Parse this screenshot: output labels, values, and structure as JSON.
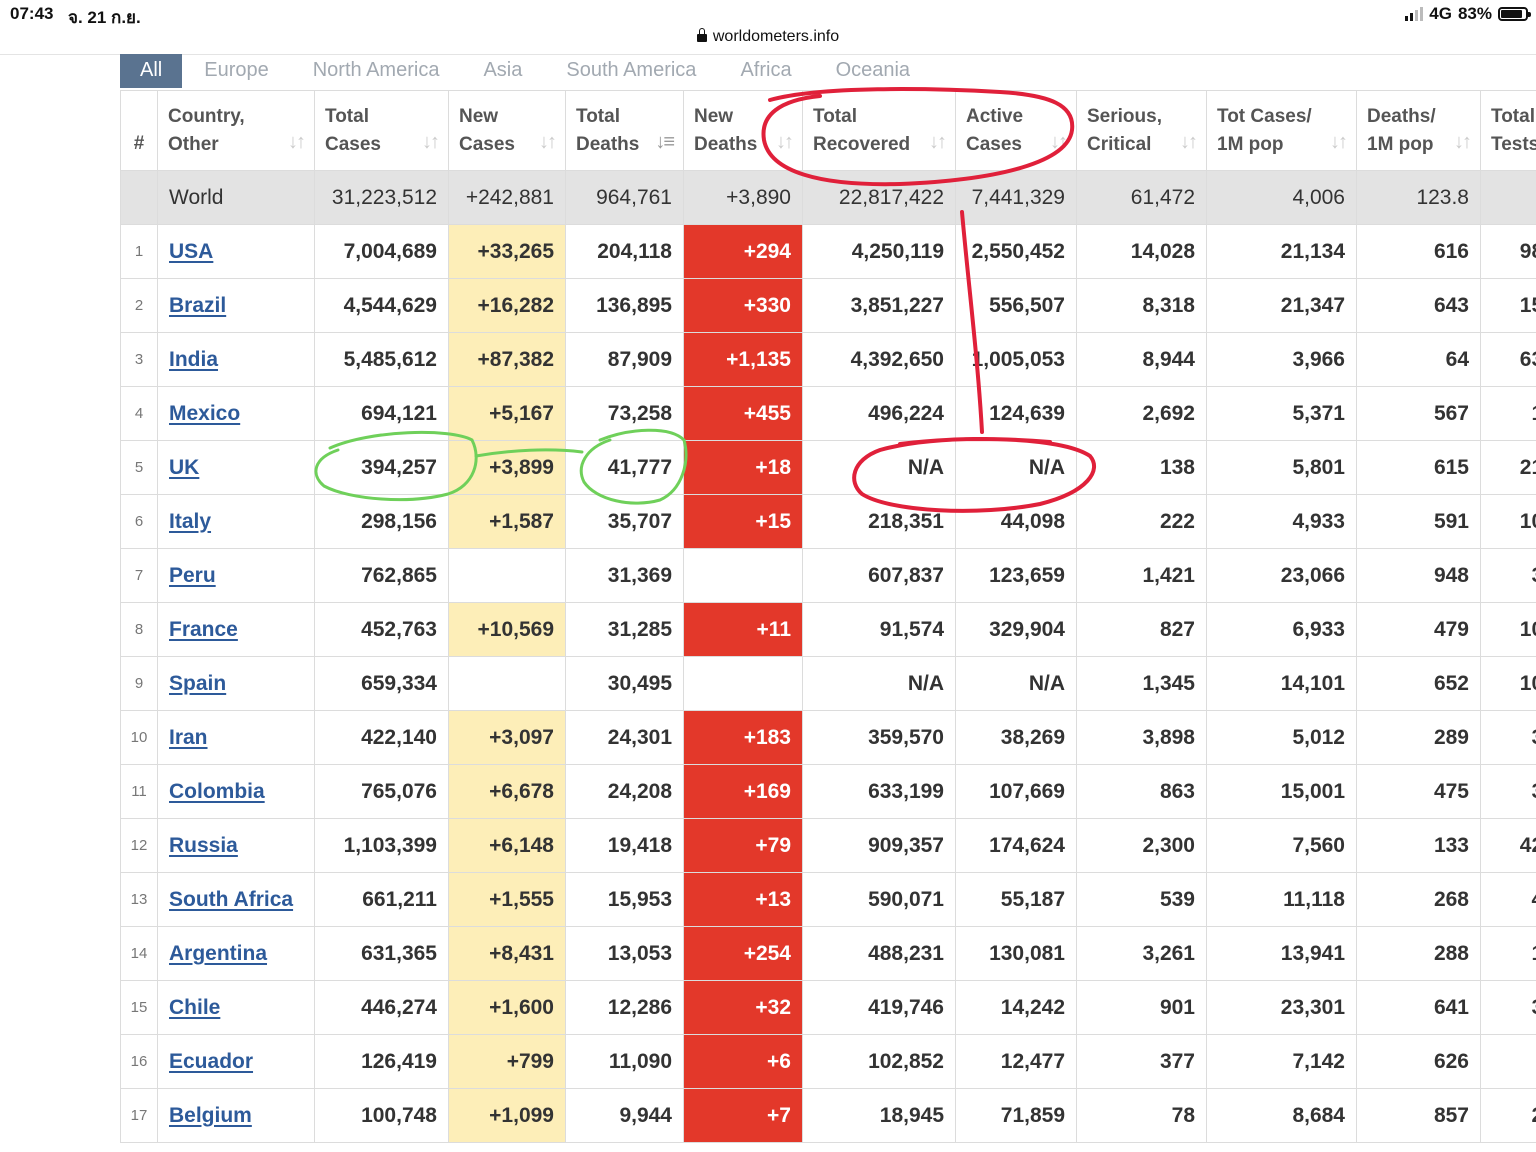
{
  "status_bar": {
    "time": "07:43",
    "date": "จ. 21 ก.ย.",
    "network": "4G",
    "battery": "83%"
  },
  "url_bar": {
    "domain": "worldometers.info"
  },
  "region_tabs": [
    "All",
    "Europe",
    "North America",
    "Asia",
    "South America",
    "Africa",
    "Oceania"
  ],
  "active_tab": "All",
  "table": {
    "headers": [
      {
        "line1": "#",
        "line2": ""
      },
      {
        "line1": "Country,",
        "line2": "Other"
      },
      {
        "line1": "Total",
        "line2": "Cases"
      },
      {
        "line1": "New",
        "line2": "Cases"
      },
      {
        "line1": "Total",
        "line2": "Deaths"
      },
      {
        "line1": "New",
        "line2": "Deaths"
      },
      {
        "line1": "Total",
        "line2": "Recovered"
      },
      {
        "line1": "Active",
        "line2": "Cases"
      },
      {
        "line1": "Serious,",
        "line2": "Critical"
      },
      {
        "line1": "Tot Cases/",
        "line2": "1M pop"
      },
      {
        "line1": "Deaths/",
        "line2": "1M pop"
      },
      {
        "line1": "Total",
        "line2": "Tests"
      }
    ],
    "world_row": {
      "country": "World",
      "total_cases": "31,223,512",
      "new_cases": "+242,881",
      "total_deaths": "964,761",
      "new_deaths": "+3,890",
      "total_recovered": "22,817,422",
      "active_cases": "7,441,329",
      "serious_critical": "61,472",
      "cases_per_1m": "4,006",
      "deaths_per_1m": "123.8",
      "total_tests": ""
    },
    "rows": [
      {
        "rank": "1",
        "country": "USA",
        "total_cases": "7,004,689",
        "new_cases": "+33,265",
        "total_deaths": "204,118",
        "new_deaths": "+294",
        "total_recovered": "4,250,119",
        "active_cases": "2,550,452",
        "serious_critical": "14,028",
        "cases_per_1m": "21,134",
        "deaths_per_1m": "616",
        "total_tests": "98,"
      },
      {
        "rank": "2",
        "country": "Brazil",
        "total_cases": "4,544,629",
        "new_cases": "+16,282",
        "total_deaths": "136,895",
        "new_deaths": "+330",
        "total_recovered": "3,851,227",
        "active_cases": "556,507",
        "serious_critical": "8,318",
        "cases_per_1m": "21,347",
        "deaths_per_1m": "643",
        "total_tests": "15,"
      },
      {
        "rank": "3",
        "country": "India",
        "total_cases": "5,485,612",
        "new_cases": "+87,382",
        "total_deaths": "87,909",
        "new_deaths": "+1,135",
        "total_recovered": "4,392,650",
        "active_cases": "1,005,053",
        "serious_critical": "8,944",
        "cases_per_1m": "3,966",
        "deaths_per_1m": "64",
        "total_tests": "63,"
      },
      {
        "rank": "4",
        "country": "Mexico",
        "total_cases": "694,121",
        "new_cases": "+5,167",
        "total_deaths": "73,258",
        "new_deaths": "+455",
        "total_recovered": "496,224",
        "active_cases": "124,639",
        "serious_critical": "2,692",
        "cases_per_1m": "5,371",
        "deaths_per_1m": "567",
        "total_tests": "1,"
      },
      {
        "rank": "5",
        "country": "UK",
        "total_cases": "394,257",
        "new_cases": "+3,899",
        "total_deaths": "41,777",
        "new_deaths": "+18",
        "total_recovered": "N/A",
        "active_cases": "N/A",
        "serious_critical": "138",
        "cases_per_1m": "5,801",
        "deaths_per_1m": "615",
        "total_tests": "21,"
      },
      {
        "rank": "6",
        "country": "Italy",
        "total_cases": "298,156",
        "new_cases": "+1,587",
        "total_deaths": "35,707",
        "new_deaths": "+15",
        "total_recovered": "218,351",
        "active_cases": "44,098",
        "serious_critical": "222",
        "cases_per_1m": "4,933",
        "deaths_per_1m": "591",
        "total_tests": "10,"
      },
      {
        "rank": "7",
        "country": "Peru",
        "total_cases": "762,865",
        "new_cases": "",
        "total_deaths": "31,369",
        "new_deaths": "",
        "total_recovered": "607,837",
        "active_cases": "123,659",
        "serious_critical": "1,421",
        "cases_per_1m": "23,066",
        "deaths_per_1m": "948",
        "total_tests": "3,"
      },
      {
        "rank": "8",
        "country": "France",
        "total_cases": "452,763",
        "new_cases": "+10,569",
        "total_deaths": "31,285",
        "new_deaths": "+11",
        "total_recovered": "91,574",
        "active_cases": "329,904",
        "serious_critical": "827",
        "cases_per_1m": "6,933",
        "deaths_per_1m": "479",
        "total_tests": "10,"
      },
      {
        "rank": "9",
        "country": "Spain",
        "total_cases": "659,334",
        "new_cases": "",
        "total_deaths": "30,495",
        "new_deaths": "",
        "total_recovered": "N/A",
        "active_cases": "N/A",
        "serious_critical": "1,345",
        "cases_per_1m": "14,101",
        "deaths_per_1m": "652",
        "total_tests": "10,"
      },
      {
        "rank": "10",
        "country": "Iran",
        "total_cases": "422,140",
        "new_cases": "+3,097",
        "total_deaths": "24,301",
        "new_deaths": "+183",
        "total_recovered": "359,570",
        "active_cases": "38,269",
        "serious_critical": "3,898",
        "cases_per_1m": "5,012",
        "deaths_per_1m": "289",
        "total_tests": "3,"
      },
      {
        "rank": "11",
        "country": "Colombia",
        "total_cases": "765,076",
        "new_cases": "+6,678",
        "total_deaths": "24,208",
        "new_deaths": "+169",
        "total_recovered": "633,199",
        "active_cases": "107,669",
        "serious_critical": "863",
        "cases_per_1m": "15,001",
        "deaths_per_1m": "475",
        "total_tests": "3,"
      },
      {
        "rank": "12",
        "country": "Russia",
        "total_cases": "1,103,399",
        "new_cases": "+6,148",
        "total_deaths": "19,418",
        "new_deaths": "+79",
        "total_recovered": "909,357",
        "active_cases": "174,624",
        "serious_critical": "2,300",
        "cases_per_1m": "7,560",
        "deaths_per_1m": "133",
        "total_tests": "42,"
      },
      {
        "rank": "13",
        "country": "South Africa",
        "total_cases": "661,211",
        "new_cases": "+1,555",
        "total_deaths": "15,953",
        "new_deaths": "+13",
        "total_recovered": "590,071",
        "active_cases": "55,187",
        "serious_critical": "539",
        "cases_per_1m": "11,118",
        "deaths_per_1m": "268",
        "total_tests": "4,"
      },
      {
        "rank": "14",
        "country": "Argentina",
        "total_cases": "631,365",
        "new_cases": "+8,431",
        "total_deaths": "13,053",
        "new_deaths": "+254",
        "total_recovered": "488,231",
        "active_cases": "130,081",
        "serious_critical": "3,261",
        "cases_per_1m": "13,941",
        "deaths_per_1m": "288",
        "total_tests": "1,"
      },
      {
        "rank": "15",
        "country": "Chile",
        "total_cases": "446,274",
        "new_cases": "+1,600",
        "total_deaths": "12,286",
        "new_deaths": "+32",
        "total_recovered": "419,746",
        "active_cases": "14,242",
        "serious_critical": "901",
        "cases_per_1m": "23,301",
        "deaths_per_1m": "641",
        "total_tests": "3,"
      },
      {
        "rank": "16",
        "country": "Ecuador",
        "total_cases": "126,419",
        "new_cases": "+799",
        "total_deaths": "11,090",
        "new_deaths": "+6",
        "total_recovered": "102,852",
        "active_cases": "12,477",
        "serious_critical": "377",
        "cases_per_1m": "7,142",
        "deaths_per_1m": "626",
        "total_tests": ""
      },
      {
        "rank": "17",
        "country": "Belgium",
        "total_cases": "100,748",
        "new_cases": "+1,099",
        "total_deaths": "9,944",
        "new_deaths": "+7",
        "total_recovered": "18,945",
        "active_cases": "71,859",
        "serious_critical": "78",
        "cases_per_1m": "8,684",
        "deaths_per_1m": "857",
        "total_tests": "2,"
      }
    ]
  },
  "colors": {
    "tab_active_bg": "#5a7390",
    "tab_inactive_text": "#a2a9b1",
    "new_cases_bg": "#fdeeb8",
    "new_deaths_bg": "#e3382a",
    "world_row_bg": "#e3e3e3",
    "country_link": "#2d5a9a",
    "annotation_red": "#e0203a",
    "annotation_green": "#6fd05a"
  },
  "icons": {
    "lock": "lock-icon",
    "signal": "cellular-signal-icon",
    "battery": "battery-icon",
    "sort": "sort-arrows-icon"
  }
}
